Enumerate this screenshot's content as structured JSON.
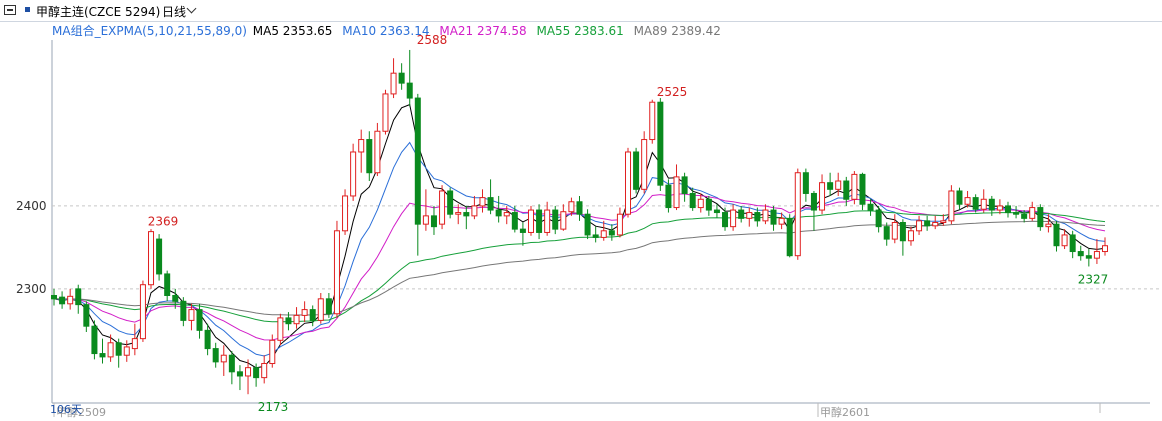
{
  "header": {
    "symbol": "甲醇主连(CZCE 5294)",
    "period": "日线",
    "menu_icon": "menu-icon",
    "dropdown_icon": "chevron-down-icon"
  },
  "legend": {
    "group": "MA组合_EXPMA(5,10,21,55,89,0)",
    "items": [
      {
        "label": "MA5 2353.65",
        "color": "#000000"
      },
      {
        "label": "MA10 2363.14",
        "color": "#2b6fd8"
      },
      {
        "label": "MA21 2374.58",
        "color": "#d21ec8"
      },
      {
        "label": "MA55 2383.61",
        "color": "#16a03a"
      },
      {
        "label": "MA89 2389.42",
        "color": "#777777"
      }
    ],
    "group_color": "#2b6fd8"
  },
  "chart_data": {
    "type": "candlestick",
    "y_ticks": [
      "2400",
      "2300"
    ],
    "ylim": [
      2160,
      2600
    ],
    "x_labels": [
      "甲醇2509",
      "甲醇2601"
    ],
    "corner_label": "106天",
    "annotations": [
      {
        "text": "2369",
        "value": 2369
      },
      {
        "text": "2173",
        "value": 2173
      },
      {
        "text": "2588",
        "value": 2588
      },
      {
        "text": "2525",
        "value": 2525
      },
      {
        "text": "2327",
        "value": 2327
      }
    ],
    "colors": {
      "up": "#e02020",
      "down": "#0a8a1e",
      "grid": "#c8c8c8"
    },
    "candles": [
      [
        2292,
        2288,
        2300,
        2280
      ],
      [
        2290,
        2282,
        2297,
        2276
      ],
      [
        2282,
        2291,
        2300,
        2275
      ],
      [
        2300,
        2281,
        2305,
        2270
      ],
      [
        2281,
        2255,
        2285,
        2248
      ],
      [
        2255,
        2222,
        2262,
        2215
      ],
      [
        2222,
        2218,
        2240,
        2210
      ],
      [
        2218,
        2235,
        2245,
        2212
      ],
      [
        2235,
        2220,
        2240,
        2205
      ],
      [
        2220,
        2230,
        2238,
        2212
      ],
      [
        2228,
        2240,
        2258,
        2220
      ],
      [
        2240,
        2305,
        2310,
        2236
      ],
      [
        2305,
        2369,
        2372,
        2300
      ],
      [
        2360,
        2318,
        2366,
        2310
      ],
      [
        2318,
        2292,
        2322,
        2285
      ],
      [
        2292,
        2285,
        2300,
        2276
      ],
      [
        2285,
        2262,
        2290,
        2255
      ],
      [
        2262,
        2275,
        2282,
        2250
      ],
      [
        2275,
        2250,
        2282,
        2240
      ],
      [
        2250,
        2228,
        2258,
        2220
      ],
      [
        2228,
        2212,
        2235,
        2205
      ],
      [
        2212,
        2220,
        2232,
        2195
      ],
      [
        2220,
        2200,
        2225,
        2185
      ],
      [
        2200,
        2195,
        2208,
        2178
      ],
      [
        2195,
        2205,
        2215,
        2173
      ],
      [
        2205,
        2193,
        2210,
        2182
      ],
      [
        2193,
        2210,
        2220,
        2186
      ],
      [
        2210,
        2238,
        2245,
        2205
      ],
      [
        2238,
        2265,
        2270,
        2232
      ],
      [
        2265,
        2258,
        2272,
        2250
      ],
      [
        2258,
        2268,
        2278,
        2252
      ],
      [
        2268,
        2275,
        2285,
        2260
      ],
      [
        2275,
        2262,
        2280,
        2255
      ],
      [
        2262,
        2288,
        2295,
        2258
      ],
      [
        2288,
        2270,
        2295,
        2265
      ],
      [
        2270,
        2370,
        2382,
        2265
      ],
      [
        2370,
        2412,
        2420,
        2365
      ],
      [
        2412,
        2465,
        2475,
        2406
      ],
      [
        2465,
        2480,
        2492,
        2440
      ],
      [
        2480,
        2440,
        2490,
        2430
      ],
      [
        2440,
        2490,
        2500,
        2436
      ],
      [
        2490,
        2535,
        2540,
        2486
      ],
      [
        2535,
        2560,
        2578,
        2530
      ],
      [
        2560,
        2548,
        2572,
        2540
      ],
      [
        2548,
        2530,
        2588,
        2520
      ],
      [
        2530,
        2378,
        2535,
        2340
      ],
      [
        2378,
        2388,
        2420,
        2370
      ],
      [
        2388,
        2375,
        2400,
        2365
      ],
      [
        2378,
        2418,
        2425,
        2372
      ],
      [
        2418,
        2390,
        2422,
        2385
      ],
      [
        2390,
        2392,
        2402,
        2378
      ],
      [
        2392,
        2388,
        2400,
        2372
      ],
      [
        2388,
        2400,
        2412,
        2384
      ],
      [
        2400,
        2410,
        2420,
        2392
      ],
      [
        2410,
        2395,
        2432,
        2390
      ],
      [
        2395,
        2388,
        2412,
        2380
      ],
      [
        2388,
        2392,
        2400,
        2378
      ],
      [
        2392,
        2372,
        2400,
        2368
      ],
      [
        2372,
        2368,
        2380,
        2352
      ],
      [
        2368,
        2395,
        2400,
        2364
      ],
      [
        2395,
        2368,
        2402,
        2360
      ],
      [
        2368,
        2395,
        2405,
        2364
      ],
      [
        2395,
        2372,
        2400,
        2366
      ],
      [
        2372,
        2393,
        2402,
        2370
      ],
      [
        2393,
        2405,
        2410,
        2388
      ],
      [
        2405,
        2390,
        2412,
        2382
      ],
      [
        2390,
        2365,
        2396,
        2360
      ],
      [
        2365,
        2362,
        2375,
        2356
      ],
      [
        2362,
        2370,
        2382,
        2358
      ],
      [
        2370,
        2365,
        2378,
        2358
      ],
      [
        2365,
        2390,
        2398,
        2362
      ],
      [
        2390,
        2465,
        2470,
        2386
      ],
      [
        2465,
        2420,
        2470,
        2415
      ],
      [
        2420,
        2480,
        2490,
        2415
      ],
      [
        2480,
        2525,
        2528,
        2475
      ],
      [
        2525,
        2425,
        2530,
        2418
      ],
      [
        2425,
        2398,
        2432,
        2392
      ],
      [
        2398,
        2435,
        2450,
        2395
      ],
      [
        2435,
        2415,
        2440,
        2405
      ],
      [
        2415,
        2398,
        2422,
        2394
      ],
      [
        2398,
        2408,
        2415,
        2392
      ],
      [
        2408,
        2395,
        2412,
        2388
      ],
      [
        2395,
        2392,
        2402,
        2386
      ],
      [
        2392,
        2375,
        2398,
        2370
      ],
      [
        2375,
        2395,
        2402,
        2370
      ],
      [
        2395,
        2385,
        2400,
        2380
      ],
      [
        2385,
        2392,
        2398,
        2375
      ],
      [
        2392,
        2382,
        2398,
        2375
      ],
      [
        2382,
        2395,
        2402,
        2378
      ],
      [
        2395,
        2378,
        2400,
        2370
      ],
      [
        2378,
        2385,
        2392,
        2372
      ],
      [
        2385,
        2340,
        2390,
        2338
      ],
      [
        2340,
        2440,
        2445,
        2335
      ],
      [
        2440,
        2415,
        2445,
        2405
      ],
      [
        2415,
        2395,
        2418,
        2370
      ],
      [
        2395,
        2428,
        2438,
        2390
      ],
      [
        2428,
        2420,
        2440,
        2412
      ],
      [
        2420,
        2430,
        2440,
        2412
      ],
      [
        2430,
        2408,
        2435,
        2400
      ],
      [
        2408,
        2438,
        2442,
        2402
      ],
      [
        2438,
        2402,
        2440,
        2395
      ],
      [
        2402,
        2395,
        2408,
        2388
      ],
      [
        2395,
        2375,
        2400,
        2368
      ],
      [
        2375,
        2360,
        2380,
        2352
      ],
      [
        2360,
        2380,
        2390,
        2355
      ],
      [
        2380,
        2358,
        2384,
        2340
      ],
      [
        2358,
        2370,
        2375,
        2352
      ],
      [
        2370,
        2382,
        2388,
        2365
      ],
      [
        2382,
        2376,
        2388,
        2370
      ],
      [
        2376,
        2380,
        2388,
        2372
      ],
      [
        2380,
        2382,
        2390,
        2376
      ],
      [
        2382,
        2418,
        2425,
        2378
      ],
      [
        2418,
        2402,
        2422,
        2396
      ],
      [
        2402,
        2410,
        2418,
        2398
      ],
      [
        2410,
        2396,
        2414,
        2392
      ],
      [
        2396,
        2408,
        2420,
        2392
      ],
      [
        2408,
        2395,
        2412,
        2388
      ],
      [
        2395,
        2400,
        2408,
        2390
      ],
      [
        2400,
        2392,
        2405,
        2386
      ],
      [
        2392,
        2390,
        2400,
        2385
      ],
      [
        2390,
        2385,
        2395,
        2380
      ],
      [
        2385,
        2398,
        2405,
        2382
      ],
      [
        2398,
        2375,
        2402,
        2370
      ],
      [
        2375,
        2378,
        2390,
        2368
      ],
      [
        2378,
        2352,
        2382,
        2345
      ],
      [
        2352,
        2365,
        2372,
        2348
      ],
      [
        2365,
        2345,
        2370,
        2337
      ],
      [
        2345,
        2340,
        2352,
        2334
      ],
      [
        2340,
        2337,
        2348,
        2327
      ],
      [
        2337,
        2345,
        2360,
        2330
      ],
      [
        2345,
        2352,
        2362,
        2340
      ]
    ]
  }
}
